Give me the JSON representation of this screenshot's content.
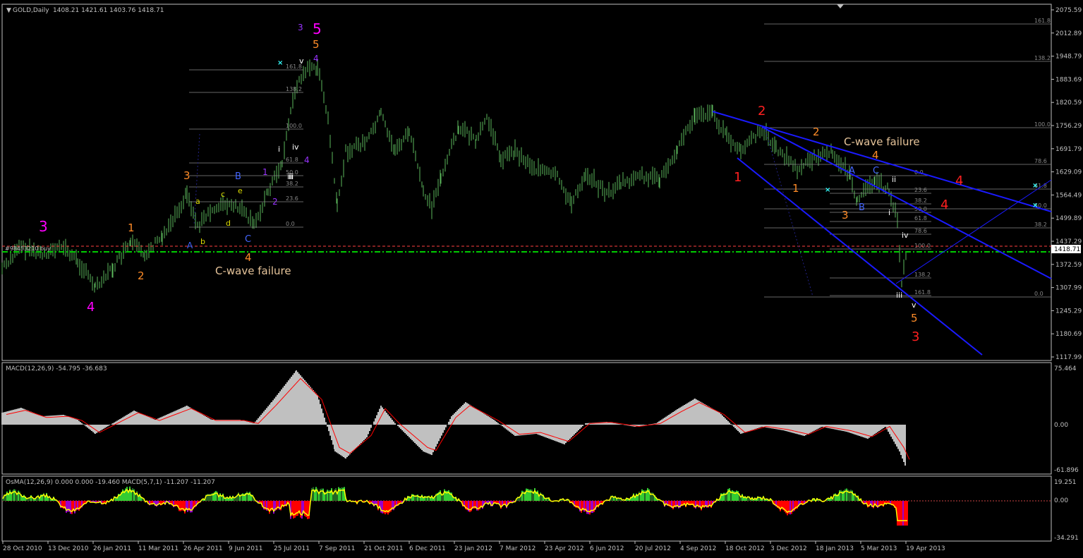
{
  "header": {
    "symbol": "GOLD,Daily",
    "ohlc": "1408.21 1421.61 1403.76 1418.71"
  },
  "order_label": "#98453210 buy",
  "current_price": "1418.71",
  "price_axis": [
    "2075.59",
    "2012.89",
    "1948.79",
    "1883.69",
    "1820.59",
    "1756.29",
    "1691.79",
    "1629.09",
    "1564.49",
    "1499.89",
    "1437.29",
    "1372.59",
    "1307.99",
    "1245.29",
    "1180.69",
    "1117.99"
  ],
  "date_axis": [
    "28 Oct 2010",
    "13 Dec 2010",
    "26 Jan 2011",
    "11 Mar 2011",
    "26 Apr 2011",
    "9 Jun 2011",
    "25 Jul 2011",
    "7 Sep 2011",
    "21 Oct 2011",
    "6 Dec 2011",
    "23 Jan 2012",
    "7 Mar 2012",
    "23 Apr 2012",
    "6 Jun 2012",
    "20 Jul 2012",
    "4 Sep 2012",
    "18 Oct 2012",
    "3 Dec 2012",
    "18 Jan 2013",
    "5 Mar 2013",
    "19 Apr 2013"
  ],
  "macd": {
    "label": "MACD(12,26,9) -54.795 -36.683",
    "axis": [
      "75.464",
      "0.00",
      "-61.896"
    ]
  },
  "osma": {
    "label": "OsMA(12,26,9) 0.000 0.000 -19.460  MACD(5,7,1) -11.207 -11.207",
    "axis": [
      "19.251",
      "0.00",
      "-34.291"
    ]
  },
  "annotations": {
    "c_wave_left": "C-wave failure",
    "c_wave_right": "C-wave failure"
  },
  "wave_labels": [
    {
      "t": "3",
      "c": "#ff00ff"
    },
    {
      "t": "4",
      "c": "#ff00ff"
    },
    {
      "t": "5",
      "c": "#ff00ff"
    },
    {
      "t": "1",
      "c": "#ff8c28"
    },
    {
      "t": "2",
      "c": "#ff8c28"
    },
    {
      "t": "3",
      "c": "#ff8c28"
    },
    {
      "t": "4",
      "c": "#ff8c28"
    },
    {
      "t": "5",
      "c": "#ff8c28"
    },
    {
      "t": "a",
      "c": "#dddd00"
    },
    {
      "t": "b",
      "c": "#dddd00"
    },
    {
      "t": "c",
      "c": "#dddd00"
    },
    {
      "t": "d",
      "c": "#dddd00"
    },
    {
      "t": "e",
      "c": "#dddd00"
    },
    {
      "t": "A",
      "c": "#4466ff"
    },
    {
      "t": "B",
      "c": "#4466ff"
    },
    {
      "t": "C",
      "c": "#4466ff"
    },
    {
      "t": "1",
      "c": "#9933ff"
    },
    {
      "t": "2",
      "c": "#9933ff"
    },
    {
      "t": "3",
      "c": "#9933ff"
    },
    {
      "t": "4",
      "c": "#9933ff"
    },
    {
      "t": "4",
      "c": "#9933ff"
    },
    {
      "t": "i",
      "c": "#ffffff"
    },
    {
      "t": "ii",
      "c": "#ffffff"
    },
    {
      "t": "iii",
      "c": "#ffffff"
    },
    {
      "t": "iv",
      "c": "#ffffff"
    },
    {
      "t": "v",
      "c": "#ffffff"
    },
    {
      "t": "1",
      "c": "#ff2020"
    },
    {
      "t": "2",
      "c": "#ff2020"
    },
    {
      "t": "3",
      "c": "#ff2020"
    },
    {
      "t": "4",
      "c": "#ff2020"
    },
    {
      "t": "4",
      "c": "#ff2020"
    },
    {
      "t": "1",
      "c": "#ff8c28"
    },
    {
      "t": "2",
      "c": "#ff8c28"
    },
    {
      "t": "3",
      "c": "#ff8c28"
    },
    {
      "t": "4",
      "c": "#ff8c28"
    },
    {
      "t": "5",
      "c": "#ff8c28"
    },
    {
      "t": "A",
      "c": "#4466ff"
    },
    {
      "t": "B",
      "c": "#4466ff"
    },
    {
      "t": "C",
      "c": "#4466ff"
    },
    {
      "t": "i",
      "c": "#ffffff"
    },
    {
      "t": "ii",
      "c": "#ffffff"
    },
    {
      "t": "iii",
      "c": "#ffffff"
    },
    {
      "t": "iv",
      "c": "#ffffff"
    },
    {
      "t": "v",
      "c": "#ffffff"
    }
  ],
  "fib_left": [
    "161.8",
    "138.2",
    "100.0",
    "61.8",
    "50.0",
    "38.2",
    "23.6",
    "0.0"
  ],
  "fib_right_a": [
    "161.8",
    "138.2",
    "100.0",
    "78.6",
    "61.8",
    "50.0",
    "38.2",
    "0.0"
  ],
  "fib_right_b": [
    "0.0",
    "23.6",
    "38.2",
    "50.0",
    "61.8",
    "78.6",
    "100.0",
    "138.2",
    "161.8"
  ],
  "colors": {
    "background": "#000000",
    "candles": "#5cb85c",
    "axis": "#c0c0c0",
    "trendline": "#1a1aff",
    "macd_hist": "#c0c0c0",
    "signal": "#ff0000"
  },
  "chart_data": {
    "type": "line",
    "title": "GOLD,Daily",
    "series": [
      {
        "name": "GOLD,Daily",
        "x": [
          "28 Oct 2010",
          "13 Dec 2010",
          "26 Jan 2011",
          "11 Mar 2011",
          "26 Apr 2011",
          "9 Jun 2011",
          "25 Jul 2011",
          "7 Sep 2011",
          "21 Oct 2011",
          "6 Dec 2011",
          "23 Jan 2012",
          "7 Mar 2012",
          "23 Apr 2012",
          "6 Jun 2012",
          "20 Jul 2012",
          "4 Sep 2012",
          "18 Oct 2012",
          "3 Dec 2012",
          "18 Jan 2013",
          "5 Mar 2013",
          "19 Apr 2013"
        ],
        "values": [
          1345,
          1395,
          1330,
          1420,
          1510,
          1530,
          1600,
          1850,
          1640,
          1720,
          1670,
          1650,
          1640,
          1590,
          1590,
          1720,
          1760,
          1700,
          1660,
          1590,
          1400
        ]
      }
    ],
    "ylim": [
      1117.99,
      2075.59
    ]
  }
}
